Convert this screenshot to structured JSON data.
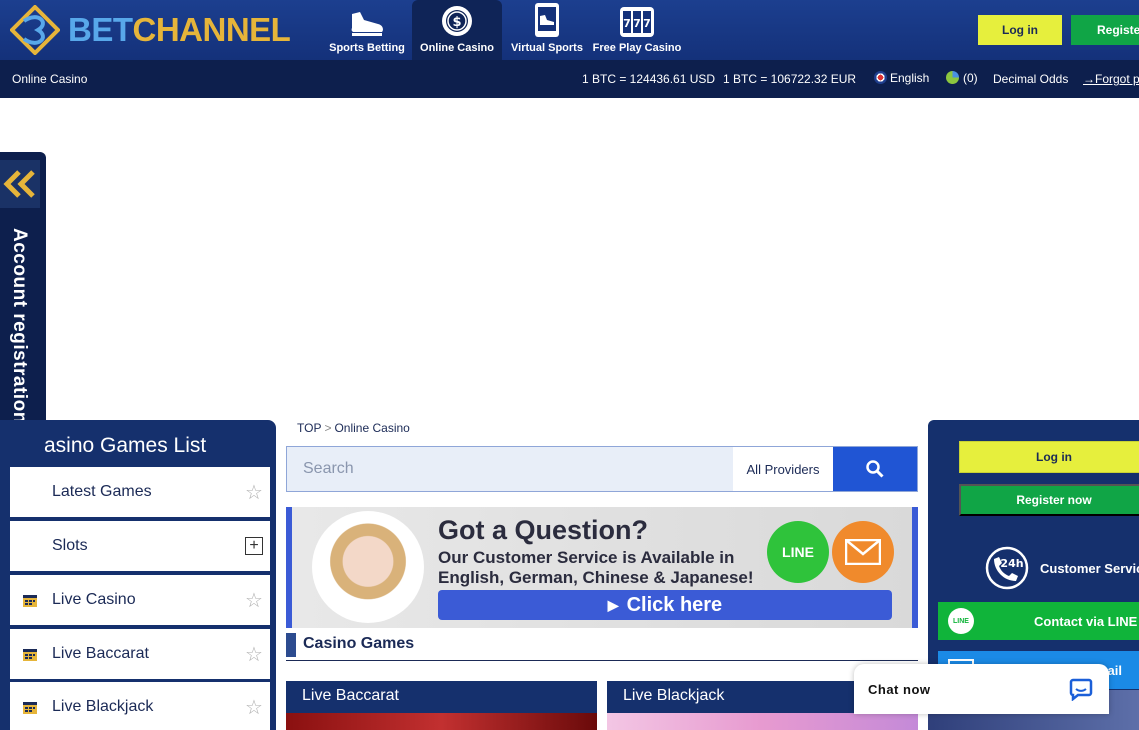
{
  "header": {
    "logo_bet": "BET",
    "logo_channel": "CHANNEL",
    "nav": [
      {
        "label": "Sports Betting",
        "icon": "shoe-icon"
      },
      {
        "label": "Online Casino",
        "icon": "casino-chip-icon",
        "active": true
      },
      {
        "label": "Virtual Sports",
        "icon": "virtual-sports-icon"
      },
      {
        "label": "Free Play Casino",
        "icon": "slot-777-icon"
      }
    ],
    "login": "Log in",
    "register": "Register"
  },
  "subbar": {
    "section": "Online Casino",
    "btc_usd": "1 BTC = 124436.61 USD",
    "btc_eur": "1 BTC = 106722.32 EUR",
    "language": "English",
    "history_count": "(0)",
    "odds": "Decimal Odds",
    "forgot": "→Forgot p"
  },
  "sidetab": {
    "label": "Account registration"
  },
  "games_list": {
    "title": "asino Games List",
    "items": [
      {
        "label": "Latest Games",
        "action": "star"
      },
      {
        "label": "Slots",
        "action": "plus"
      },
      {
        "label": "Live Casino",
        "action": "star"
      },
      {
        "label": "Live Baccarat",
        "action": "star"
      },
      {
        "label": "Live Blackjack",
        "action": "star"
      }
    ]
  },
  "breadcrumb": {
    "top": "TOP",
    "sep": ">",
    "current": "Online Casino"
  },
  "search": {
    "placeholder": "Search",
    "provider": "All Providers"
  },
  "banner": {
    "title": "Got a Question?",
    "subtitle_1": "Our Customer Service is Available in",
    "subtitle_2": "English, German, Chinese & Japanese!",
    "line_badge": "LINE",
    "cta": "Click here"
  },
  "section": {
    "title": "Casino Games"
  },
  "cards": [
    {
      "title": "Live Baccarat"
    },
    {
      "title": "Live Blackjack"
    }
  ],
  "right_panel": {
    "login": "Log in",
    "register": "Register now",
    "customer_service": "Customer Service",
    "line_contact": "Contact via LINE",
    "email_contact": "mail"
  },
  "chat": {
    "label": "Chat now"
  },
  "colors": {
    "header_blue": "#1c3f8f",
    "dark_navy": "#0d1f4d",
    "login_yellow": "#e6ef3d",
    "register_green": "#10a546",
    "accent_blue": "#2055d4"
  }
}
